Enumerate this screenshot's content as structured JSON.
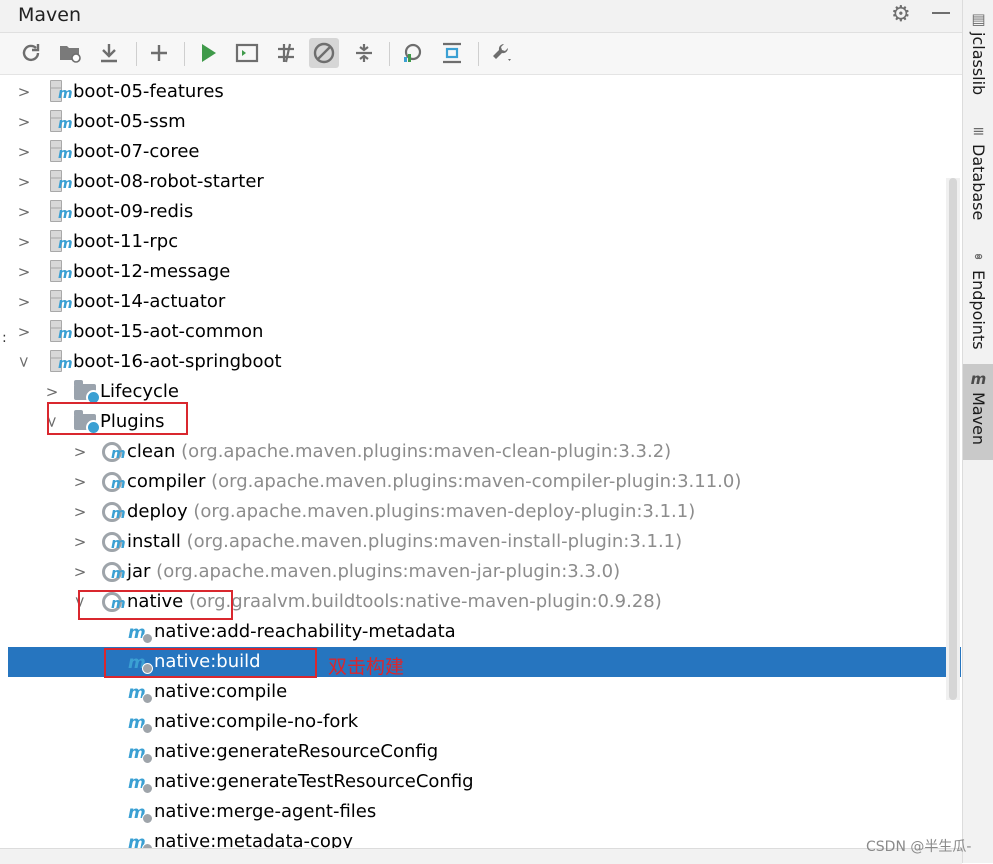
{
  "panel": {
    "title": "Maven"
  },
  "toolbar": {
    "buttons": [
      {
        "name": "reload-icon",
        "title": "Reload All Maven Projects"
      },
      {
        "name": "generate-sources-icon",
        "title": "Generate Sources"
      },
      {
        "name": "download-icon",
        "title": "Download Sources"
      },
      {
        "name": "add-icon",
        "title": "Add Maven Projects"
      },
      {
        "name": "run-icon",
        "title": "Run Maven Build"
      },
      {
        "name": "execute-goal-icon",
        "title": "Execute Maven Goal"
      },
      {
        "name": "toggle-offline-icon",
        "title": "Toggle Offline Mode"
      },
      {
        "name": "skip-tests-icon",
        "title": "Skip Tests Mode"
      },
      {
        "name": "collapse-all-icon",
        "title": "Collapse All"
      },
      {
        "name": "analyze-dependencies-icon",
        "title": "Analyze Dependencies"
      },
      {
        "name": "show-diagram-icon",
        "title": "Show Dependencies"
      },
      {
        "name": "settings-wrench-icon",
        "title": "Maven Settings"
      }
    ]
  },
  "tree": {
    "projects": [
      {
        "label": "boot-05-features"
      },
      {
        "label": "boot-05-ssm"
      },
      {
        "label": "boot-07-coree"
      },
      {
        "label": "boot-08-robot-starter"
      },
      {
        "label": "boot-09-redis"
      },
      {
        "label": "boot-11-rpc"
      },
      {
        "label": "boot-12-message"
      },
      {
        "label": "boot-14-actuator"
      },
      {
        "label": "boot-15-aot-common"
      },
      {
        "label": "boot-16-aot-springboot"
      }
    ],
    "folders": [
      {
        "label": "Lifecycle"
      },
      {
        "label": "Plugins"
      }
    ],
    "plugins": [
      {
        "label": "clean",
        "coords": "(org.apache.maven.plugins:maven-clean-plugin:3.3.2)"
      },
      {
        "label": "compiler",
        "coords": "(org.apache.maven.plugins:maven-compiler-plugin:3.11.0)"
      },
      {
        "label": "deploy",
        "coords": "(org.apache.maven.plugins:maven-deploy-plugin:3.1.1)"
      },
      {
        "label": "install",
        "coords": "(org.apache.maven.plugins:maven-install-plugin:3.1.1)"
      },
      {
        "label": "jar",
        "coords": "(org.apache.maven.plugins:maven-jar-plugin:3.3.0)"
      },
      {
        "label": "native",
        "coords": "(org.graalvm.buildtools:native-maven-plugin:0.9.28)"
      }
    ],
    "goals": [
      {
        "label": "native:add-reachability-metadata"
      },
      {
        "label": "native:build"
      },
      {
        "label": "native:compile"
      },
      {
        "label": "native:compile-no-fork"
      },
      {
        "label": "native:generateResourceConfig"
      },
      {
        "label": "native:generateTestResourceConfig"
      },
      {
        "label": "native:merge-agent-files"
      },
      {
        "label": "native:metadata-copy"
      }
    ],
    "selected_goal": "native:build"
  },
  "annotation": {
    "text": "双击构建",
    "color": "#d9272e"
  },
  "sidebar": {
    "tabs": [
      {
        "label": "jclasslib"
      },
      {
        "label": "Database"
      },
      {
        "label": "Endpoints"
      },
      {
        "label": "Maven"
      }
    ]
  },
  "watermark": "CSDN @半生瓜-",
  "colors": {
    "selection": "#2675bf",
    "maven_icon": "#3ba0d3",
    "annotation": "#d9272e"
  }
}
